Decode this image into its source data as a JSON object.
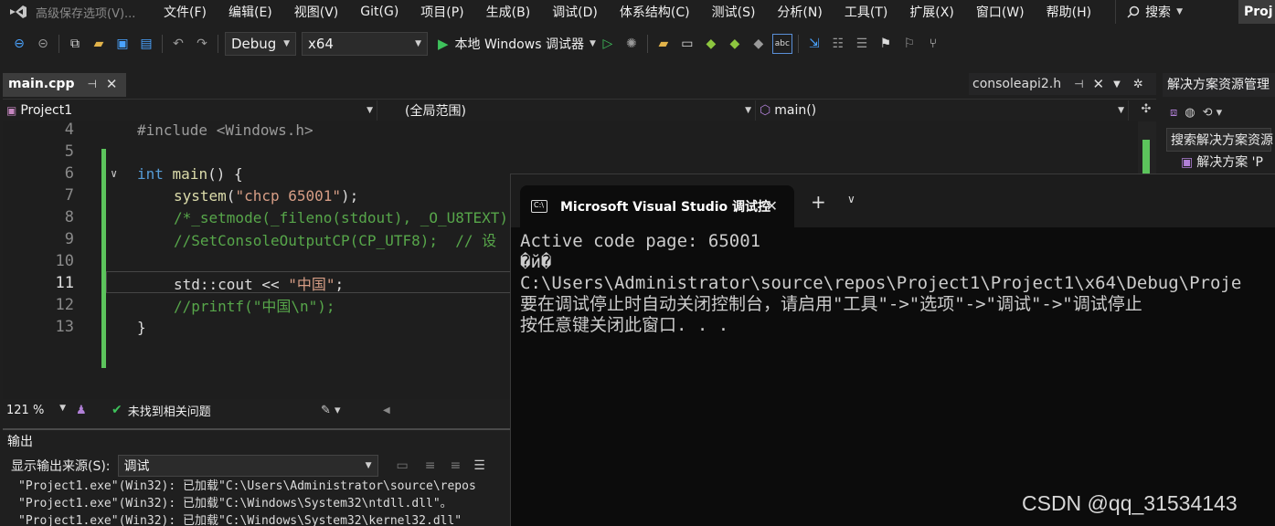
{
  "app": {
    "title": "高级保存选项(V)..."
  },
  "menu": [
    "文件(F)",
    "编辑(E)",
    "视图(V)",
    "Git(G)",
    "项目(P)",
    "生成(B)",
    "调试(D)",
    "体系结构(C)",
    "测试(S)",
    "分析(N)",
    "工具(T)",
    "扩展(X)",
    "窗口(W)",
    "帮助(H)"
  ],
  "search": {
    "label": "搜索"
  },
  "project_badge": "Proj",
  "toolbar": {
    "config": "Debug",
    "platform": "x64",
    "run_label": "本地 Windows 调试器"
  },
  "tabs": {
    "main": "main.cpp",
    "console": "consoleapi2.h"
  },
  "navbar": {
    "project": "Project1",
    "scope": "(全局范围)",
    "member": "main()"
  },
  "code": {
    "lines": [
      {
        "n": "4",
        "text": "#include <Windows.h>"
      },
      {
        "n": "5",
        "text": ""
      },
      {
        "n": "6",
        "text": "int main() {"
      },
      {
        "n": "7",
        "text": "system(\"chcp 65001\");"
      },
      {
        "n": "8",
        "text": "/*_setmode(_fileno(stdout), _O_U8TEXT)"
      },
      {
        "n": "9",
        "text": "//SetConsoleOutputCP(CP_UTF8);  // 设"
      },
      {
        "n": "10",
        "text": ""
      },
      {
        "n": "11",
        "text": "std::cout << \"中国\";"
      },
      {
        "n": "12",
        "text": "//printf(\"中国\\n\");"
      },
      {
        "n": "13",
        "text": "}"
      }
    ]
  },
  "status": {
    "zoom": "121 %",
    "issues": "未找到相关问题"
  },
  "output": {
    "title": "输出",
    "source_label": "显示输出来源(S):",
    "source_value": "调试",
    "lines": [
      "\"Project1.exe\"(Win32): 已加载\"C:\\Users\\Administrator\\source\\repos",
      "\"Project1.exe\"(Win32): 已加载\"C:\\Windows\\System32\\ntdll.dll\"。",
      "\"Project1.exe\"(Win32): 已加载\"C:\\Windows\\System32\\kernel32.dll\""
    ]
  },
  "solution_explorer": {
    "title": "解决方案资源管理",
    "search": "搜索解决方案资源",
    "root": "解决方案 'P"
  },
  "console": {
    "tab_title": "Microsoft Visual Studio 调试控",
    "lines": [
      "Active code page: 65001",
      "�й�",
      "C:\\Users\\Administrator\\source\\repos\\Project1\\Project1\\x64\\Debug\\Proje",
      "要在调试停止时自动关闭控制台，请启用\"工具\"->\"选项\"->\"调试\"->\"调试停止",
      "按任意键关闭此窗口. . ."
    ]
  },
  "watermark": "CSDN @qq_31534143",
  "colors": {
    "run_green": "#3ec15b",
    "change_bar": "#5cc45c",
    "keyword": "#569cd6",
    "comment": "#57a64a",
    "string": "#d69d85"
  }
}
